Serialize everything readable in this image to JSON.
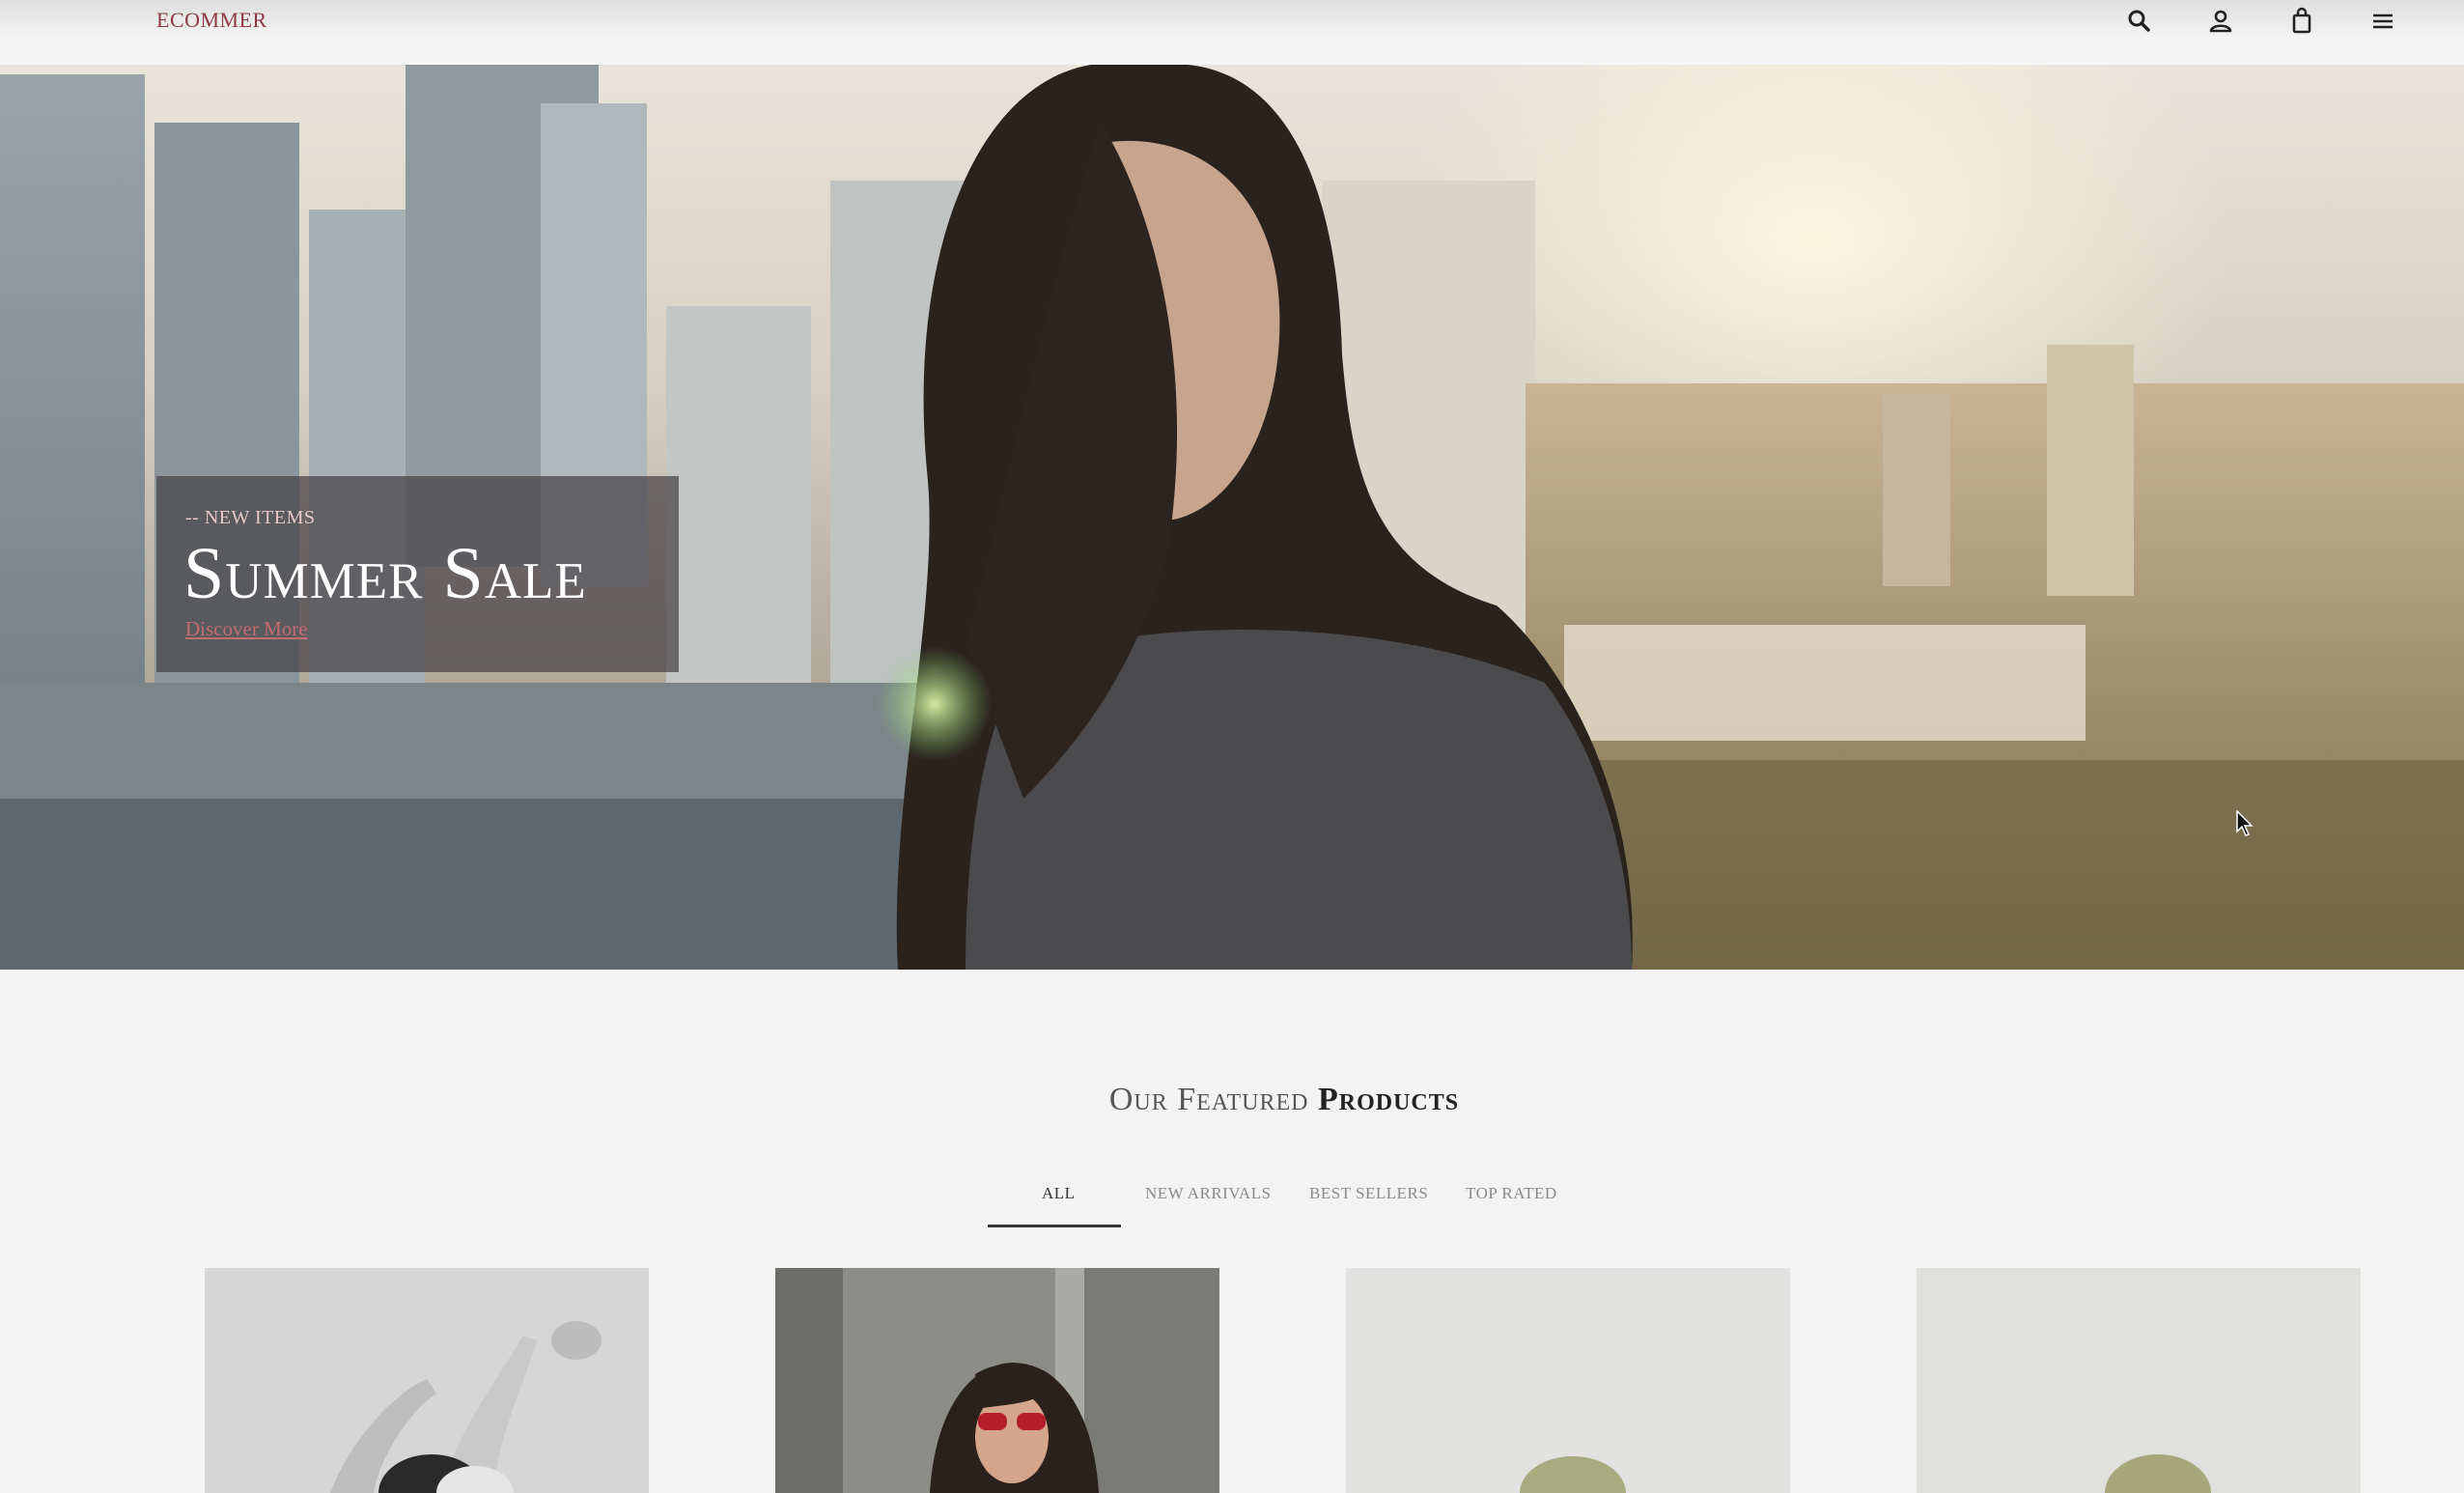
{
  "header": {
    "logo": "ECOMMER",
    "icons": [
      "search-icon",
      "user-icon",
      "shopping-bag-icon",
      "menu-icon"
    ]
  },
  "hero": {
    "kicker": "-- NEW ITEMS",
    "title": "Summer Sale",
    "link_label": "Discover More"
  },
  "featured": {
    "title_light": "Our Featured",
    "title_bold": "Products",
    "tabs": [
      {
        "label": "ALL",
        "active": true
      },
      {
        "label": "NEW ARRIVALS",
        "active": false
      },
      {
        "label": "BEST SELLERS",
        "active": false
      },
      {
        "label": "TOP RATED",
        "active": false
      }
    ]
  },
  "colors": {
    "logo": "#8e3a44",
    "link": "#c26c73",
    "accent_dark": "#333333"
  }
}
